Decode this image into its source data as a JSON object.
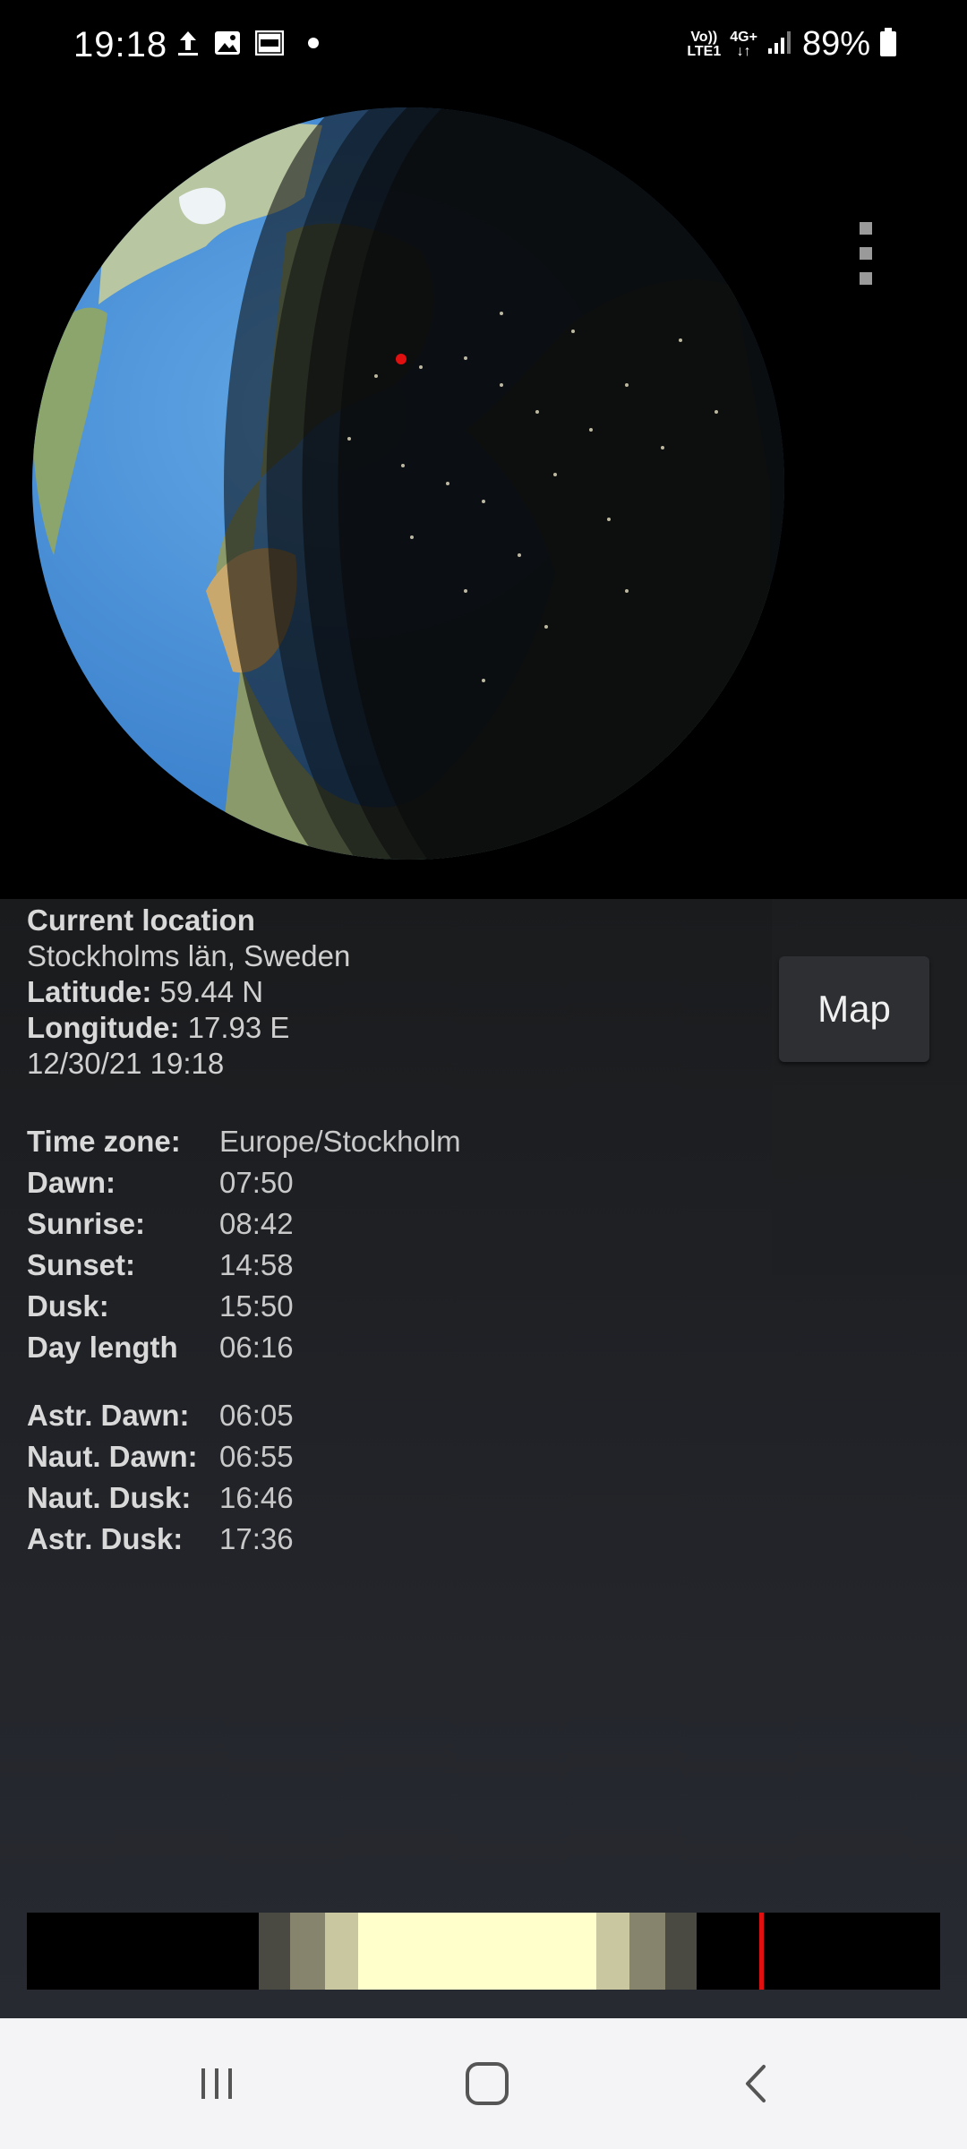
{
  "status_bar": {
    "time": "19:18",
    "network_top": "Vo))",
    "network_bottom": "LTE1",
    "data_top": "4G+",
    "battery": "89%",
    "icons": [
      "upload-icon",
      "image-icon",
      "svd-app-icon",
      "dot-icon",
      "signal-icon",
      "battery-icon"
    ]
  },
  "location": {
    "heading": "Current location",
    "place": "Stockholms län, Sweden",
    "latitude_label": "Latitude:",
    "latitude_value": " 59.44 N",
    "longitude_label": "Longitude:",
    "longitude_value": " 17.93 E",
    "datetime": "12/30/21 19:18"
  },
  "map_button": "Map",
  "times_main": [
    {
      "label": "Time zone:",
      "value": "Europe/Stockholm"
    },
    {
      "label": "Dawn:",
      "value": "07:50"
    },
    {
      "label": "Sunrise:",
      "value": "08:42"
    },
    {
      "label": "Sunset:",
      "value": "14:58"
    },
    {
      "label": "Dusk:",
      "value": "15:50"
    },
    {
      "label": "Day length",
      "value": "06:16"
    }
  ],
  "times_twilight": [
    {
      "label": "Astr. Dawn:",
      "value": "06:05"
    },
    {
      "label": "Naut. Dawn:",
      "value": "06:55"
    },
    {
      "label": "Naut. Dusk:",
      "value": "16:46"
    },
    {
      "label": "Astr. Dusk:",
      "value": "17:36"
    }
  ],
  "day_bar": {
    "current_time": "19:18",
    "colors": {
      "night": "#000000",
      "astronomical": "#4a4a42",
      "nautical": "#86846c",
      "civil": "#c9c7a0",
      "day": "#ffffcc",
      "now": "#e01010"
    }
  },
  "nav_bar": {
    "icons": [
      "recent-apps-icon",
      "home-icon",
      "back-icon"
    ]
  }
}
